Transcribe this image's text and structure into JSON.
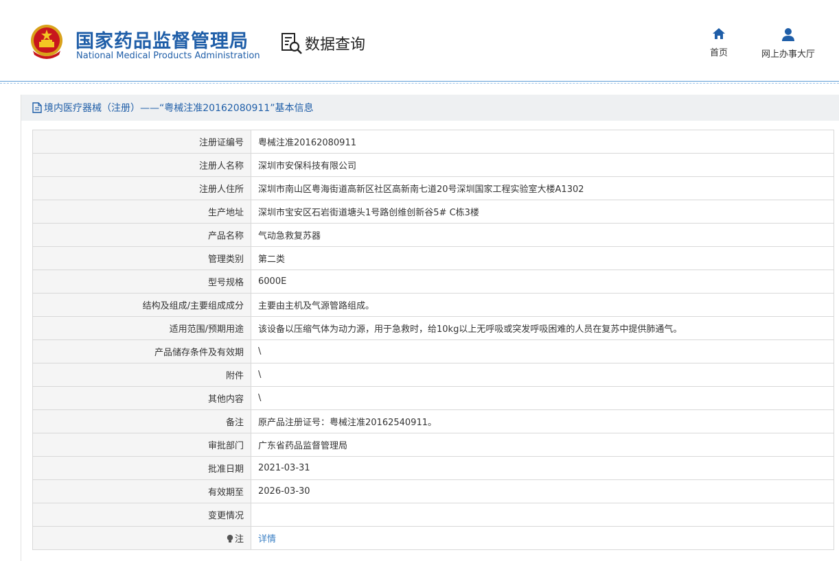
{
  "header": {
    "brand_cn": "国家药品监督管理局",
    "brand_en": "National Medical Products Administration",
    "query_label": "数据查询",
    "nav": [
      {
        "label": "首页",
        "icon": "home-icon"
      },
      {
        "label": "网上办事大厅",
        "icon": "user-icon"
      }
    ]
  },
  "panel": {
    "title": "境内医疗器械（注册）——“粤械注准20162080911”基本信息",
    "icon": "document-icon"
  },
  "rows": [
    {
      "label": "注册证编号",
      "value": "粤械注准20162080911"
    },
    {
      "label": "注册人名称",
      "value": "深圳市安保科技有限公司"
    },
    {
      "label": "注册人住所",
      "value": "深圳市南山区粤海街道高新区社区高新南七道20号深圳国家工程实验室大楼A1302"
    },
    {
      "label": "生产地址",
      "value": "深圳市宝安区石岩街道塘头1号路创维创新谷5# C栋3楼"
    },
    {
      "label": "产品名称",
      "value": "气动急救复苏器"
    },
    {
      "label": "管理类别",
      "value": "第二类"
    },
    {
      "label": "型号规格",
      "value": "6000E"
    },
    {
      "label": "结构及组成/主要组成成分",
      "value": "主要由主机及气源管路组成。"
    },
    {
      "label": "适用范围/预期用途",
      "value": "该设备以压缩气体为动力源，用于急救时，给10kg以上无呼吸或突发呼吸困难的人员在复苏中提供肺通气。"
    },
    {
      "label": "产品储存条件及有效期",
      "value": "\\"
    },
    {
      "label": "附件",
      "value": "\\"
    },
    {
      "label": "其他内容",
      "value": "\\"
    },
    {
      "label": "备注",
      "value": "原产品注册证号：粤械注准20162540911。"
    },
    {
      "label": "审批部门",
      "value": "广东省药品监督管理局"
    },
    {
      "label": "批准日期",
      "value": "2021-03-31"
    },
    {
      "label": "有效期至",
      "value": "2026-03-30"
    },
    {
      "label": "变更情况",
      "value": ""
    }
  ],
  "note_row": {
    "label": "注",
    "link_text": "详情",
    "icon": "lightbulb-icon"
  },
  "colors": {
    "brand": "#1f5ea8",
    "link": "#3a7fc4",
    "label_bg": "#f5f5f5",
    "border": "#d8d8d8",
    "head_bg": "#eef0f2"
  }
}
